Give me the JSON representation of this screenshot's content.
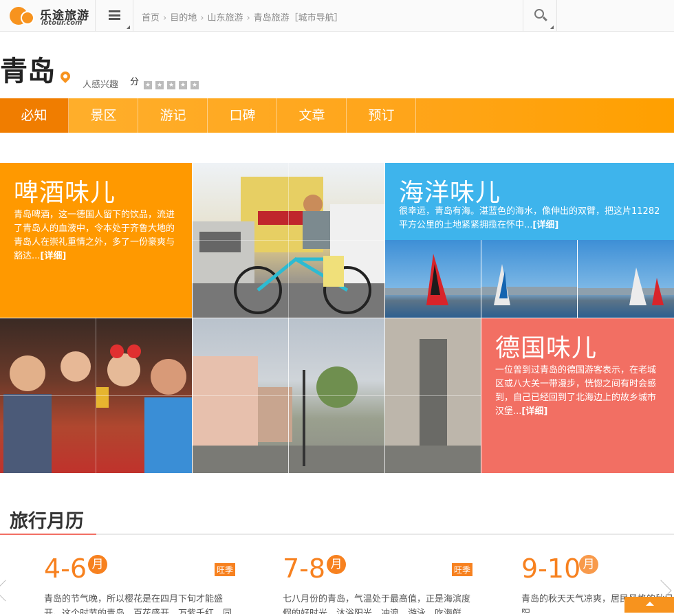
{
  "brand": {
    "name_cn": "乐途旅游",
    "name_en": "lotour.com",
    "color": "#f7931e"
  },
  "breadcrumb": [
    "首页",
    "目的地",
    "山东旅游",
    "青岛旅游［城市导航］"
  ],
  "city": {
    "name": "青岛",
    "interest_label": "人感兴趣",
    "score_label": "分",
    "stars": 5
  },
  "nav_tabs": [
    {
      "label": "必知",
      "active": true
    },
    {
      "label": "景区"
    },
    {
      "label": "游记"
    },
    {
      "label": "口碑"
    },
    {
      "label": "文章"
    },
    {
      "label": "预订"
    }
  ],
  "features": {
    "beer": {
      "title": "啤酒味儿",
      "text": "青岛啤酒，这一德国人留下的饮品，流进了青岛人的血液中，令本处于齐鲁大地的青岛人在崇礼重情之外，多了一份豪爽与豁达...",
      "more": "[详细]"
    },
    "sea": {
      "title": "海洋味儿",
      "text": "很幸运，青岛有海。湛蓝色的海水，像伸出的双臂，把这片11282平方公里的土地紧紧拥揽在怀中...",
      "more": "[详细]"
    },
    "german": {
      "title": "德国味儿",
      "text": "一位曾到过青岛的德国游客表示，在老城区或八大关一带漫步，恍惚之间有时会感到，自己已经回到了北海边上的故乡城市汉堡...",
      "more": "[详细]"
    }
  },
  "calendar": {
    "title": "旅行月历",
    "months": [
      {
        "range": "4-6",
        "unit": "月",
        "badge": "旺季",
        "text": "青岛的节气晚，所以樱花是在四月下旬才能盛开。这个时节的青岛，百花盛开，万紫千红，同时也是旅游"
      },
      {
        "range": "7-8",
        "unit": "月",
        "badge": "旺季",
        "text": "七八月份的青岛，气温处于最高值，正是海滨度假的好时光。沐浴阳光，冲浪、游泳，吃海鲜，喝着啤酒"
      },
      {
        "range": "9-10",
        "unit": "月",
        "badge": "",
        "text": "青岛的秋天天气凉爽，居民风格的秋日，密秋茂阳"
      }
    ]
  }
}
